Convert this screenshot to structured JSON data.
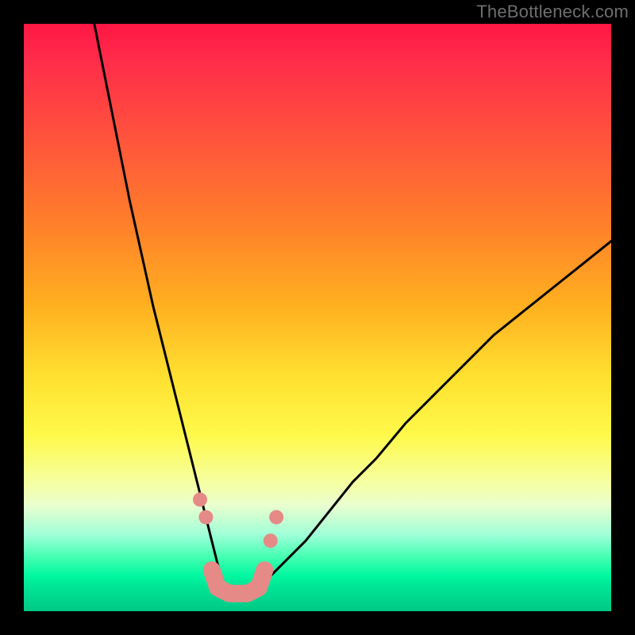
{
  "watermark": "TheBottleneck.com",
  "colors": {
    "frame": "#000000",
    "curve": "#000000",
    "marker_fill": "#e58a87",
    "marker_stroke": "#c46c69",
    "gradient_top": "#ff1744",
    "gradient_bottom": "#00c886"
  },
  "chart_data": {
    "type": "line",
    "title": "",
    "xlabel": "",
    "ylabel": "",
    "xlim": [
      0,
      100
    ],
    "ylim": [
      0,
      100
    ],
    "note": "Bottleneck-style V-curve. Y ≈ bottleneck %, X ≈ component balance. Curve minimum near x≈33–38, y≈0–4. Left branch starts near top-left (x≈12,y≈100); right branch exits near (x≈100,y≈63).",
    "series": [
      {
        "name": "left-branch",
        "x": [
          12,
          14,
          16,
          18,
          20,
          22,
          24,
          26,
          28,
          30,
          31,
          32,
          33,
          34,
          35,
          36
        ],
        "values": [
          100,
          90,
          80,
          70,
          61,
          52,
          44,
          36,
          28,
          20,
          16,
          12,
          8,
          5,
          3,
          2
        ]
      },
      {
        "name": "bottom",
        "x": [
          33,
          34,
          35,
          36,
          37,
          38,
          39,
          40,
          41
        ],
        "values": [
          4,
          3,
          2,
          2,
          2,
          2,
          3,
          4,
          5
        ]
      },
      {
        "name": "right-branch",
        "x": [
          38,
          40,
          44,
          48,
          52,
          56,
          60,
          65,
          70,
          75,
          80,
          85,
          90,
          95,
          100
        ],
        "values": [
          2,
          4,
          8,
          12,
          17,
          22,
          26,
          32,
          37,
          42,
          47,
          51,
          55,
          59,
          63
        ]
      }
    ],
    "markers": {
      "name": "highlighted-points",
      "x": [
        30,
        31,
        32,
        33,
        35,
        37,
        38,
        40,
        41,
        42,
        43
      ],
      "values": [
        19,
        16,
        7,
        4,
        3,
        3,
        3,
        4,
        7,
        12,
        16
      ]
    }
  }
}
